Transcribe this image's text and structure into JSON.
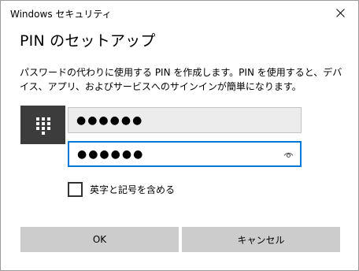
{
  "window": {
    "title": "Windows セキュリティ",
    "close_icon": "close-icon"
  },
  "dialog": {
    "heading": "PIN のセットアップ",
    "description": "パスワードの代わりに使用する PIN を作成します。PIN を使用すると、デバイス、アプリ、およびサービスへのサインインが簡単になります。",
    "pin_icon": "keypad-icon"
  },
  "fields": {
    "new_pin": {
      "value": "●●●●●●"
    },
    "confirm_pin": {
      "value": "●●●●●●",
      "reveal_icon": "eye-icon"
    }
  },
  "options": {
    "include_letters_label": "英字と記号を含める",
    "include_letters_checked": false
  },
  "buttons": {
    "ok_label": "OK",
    "cancel_label": "キャンセル"
  },
  "colors": {
    "accent": "#0078d7",
    "button_bg": "#cccccc",
    "pin_tile_bg": "#3c3c3c"
  }
}
